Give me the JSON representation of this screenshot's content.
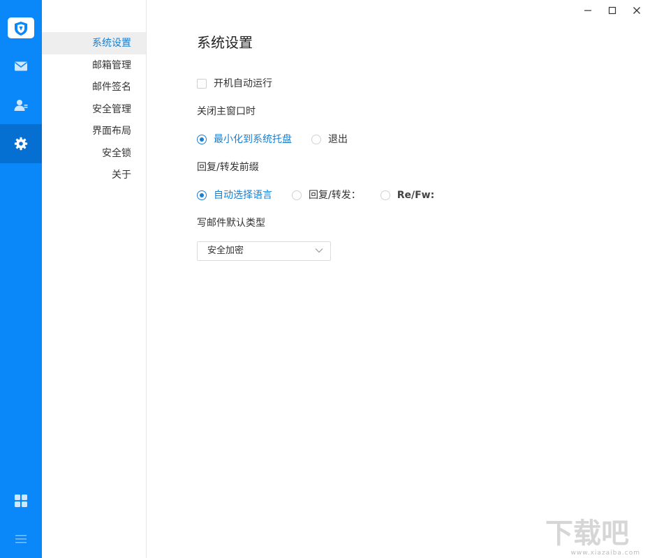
{
  "window": {
    "controls": {
      "minimize": "minimize",
      "maximize": "maximize",
      "close": "close"
    }
  },
  "rail": {
    "accent": "#0a87f8",
    "active_bg": "#0670d2",
    "items": [
      {
        "icon": "mail-icon"
      },
      {
        "icon": "contacts-icon"
      },
      {
        "icon": "settings-gear-icon",
        "active": true
      },
      {
        "icon": "apps-grid-icon"
      },
      {
        "icon": "menu-icon"
      }
    ]
  },
  "nav": {
    "items": [
      {
        "label": "系统设置",
        "active": true
      },
      {
        "label": "邮箱管理"
      },
      {
        "label": "邮件签名"
      },
      {
        "label": "安全管理"
      },
      {
        "label": "界面布局"
      },
      {
        "label": "安全锁"
      },
      {
        "label": "关于"
      }
    ]
  },
  "settings": {
    "title": "系统设置",
    "autostart": {
      "label": "开机自动运行",
      "checked": false
    },
    "close_main": {
      "label": "关闭主窗口时",
      "options": [
        {
          "label": "最小化到系统托盘",
          "selected": true
        },
        {
          "label": "退出",
          "selected": false
        }
      ]
    },
    "reply_prefix": {
      "label": "回复/转发前缀",
      "options": [
        {
          "label": "自动选择语言",
          "selected": true
        },
        {
          "label": "回复/转发：",
          "selected": false
        },
        {
          "label": "Re/Fw:",
          "selected": false
        }
      ]
    },
    "default_type": {
      "label": "写邮件默认类型",
      "value": "安全加密"
    }
  },
  "watermark": {
    "text": "下载吧",
    "sub": "www.xiazaiba.com"
  }
}
